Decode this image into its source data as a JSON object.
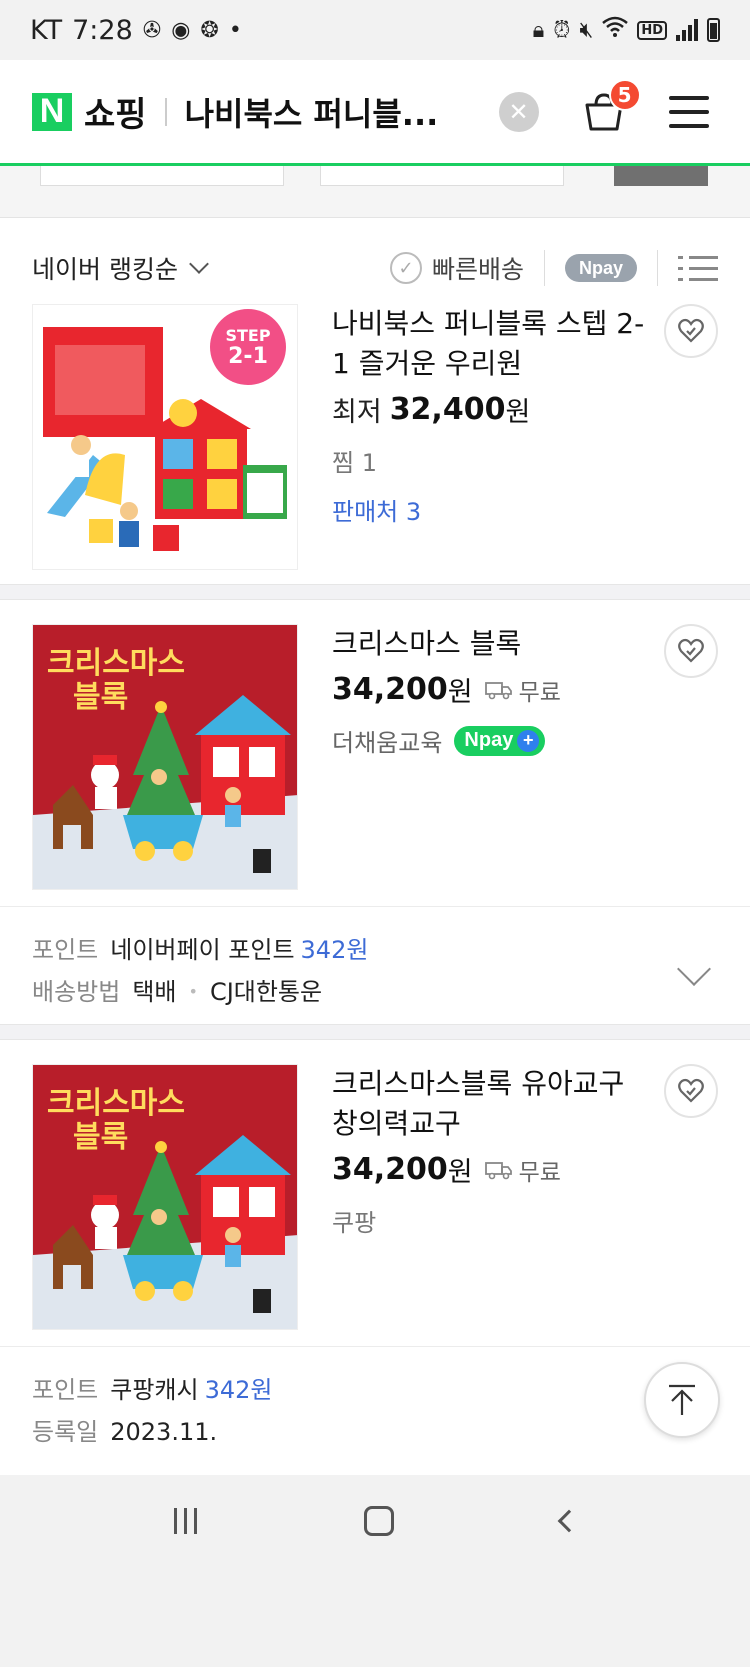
{
  "status_bar": {
    "carrier": "KT",
    "time": "7:28",
    "hd_label": "HD"
  },
  "header": {
    "logo_letter": "N",
    "service": "쇼핑",
    "search_query": "나비북스 퍼니블...",
    "cart_count": "5",
    "accent_color": "#19ce60"
  },
  "sort_bar": {
    "sort_label": "네이버 랭킹순",
    "fast_delivery": "빠른배송",
    "npay_label": "Npay"
  },
  "products": [
    {
      "title": "나비북스 퍼니블록 스텝 2-1 즐거운 우리원",
      "price_prefix": "최저",
      "price": "32,400",
      "price_unit": "원",
      "zzim": "찜 1",
      "sellers": "판매처 3",
      "thumb_badge": "STEP 2-1"
    },
    {
      "title": "크리스마스 블록",
      "price": "34,200",
      "price_unit": "원",
      "shipping": "무료",
      "seller": "더채움교육",
      "npay_label": "Npay",
      "thumb_title": "크리스마스 블록",
      "point_key": "포인트",
      "point_name": "네이버페이 포인트",
      "point_value": "342원",
      "delivery_key": "배송방법",
      "delivery_method": "택배",
      "courier": "CJ대한통운"
    },
    {
      "title": "크리스마스블록 유아교구 창의력교구",
      "price": "34,200",
      "price_unit": "원",
      "shipping": "무료",
      "seller": "쿠팡",
      "thumb_title": "크리스마스 블록",
      "point_key": "포인트",
      "point_name": "쿠팡캐시",
      "point_value": "342원",
      "reg_key": "등록일",
      "reg_date": "2023.11."
    }
  ]
}
